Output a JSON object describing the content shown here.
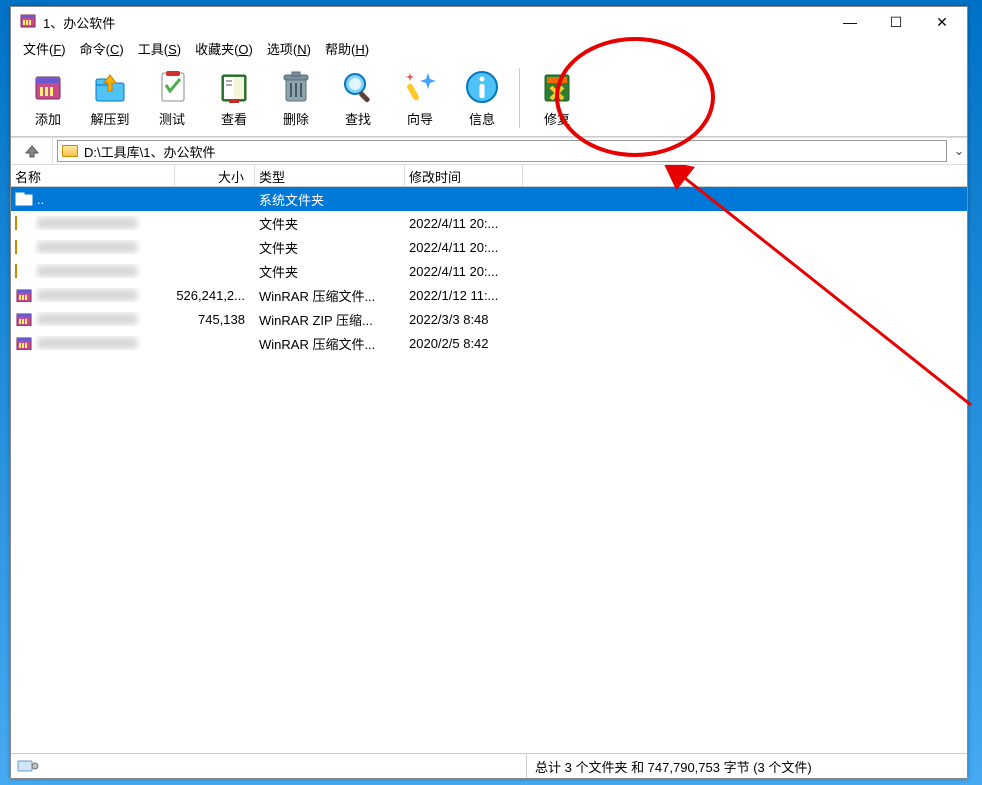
{
  "window": {
    "title": "1、办公软件",
    "controls": {
      "min": "—",
      "max": "☐",
      "close": "✕"
    }
  },
  "menubar": [
    {
      "label": "文件",
      "accel": "F"
    },
    {
      "label": "命令",
      "accel": "C"
    },
    {
      "label": "工具",
      "accel": "S"
    },
    {
      "label": "收藏夹",
      "accel": "O"
    },
    {
      "label": "选项",
      "accel": "N"
    },
    {
      "label": "帮助",
      "accel": "H"
    }
  ],
  "toolbar": [
    {
      "id": "add",
      "label": "添加"
    },
    {
      "id": "extract",
      "label": "解压到"
    },
    {
      "id": "test",
      "label": "测试"
    },
    {
      "id": "view",
      "label": "查看"
    },
    {
      "id": "delete",
      "label": "删除"
    },
    {
      "id": "find",
      "label": "查找"
    },
    {
      "id": "wizard",
      "label": "向导"
    },
    {
      "id": "info",
      "label": "信息"
    },
    {
      "id": "repair",
      "label": "修复"
    }
  ],
  "address": "D:\\工具库\\1、办公软件",
  "columns": {
    "name": "名称",
    "size": "大小",
    "type": "类型",
    "date": "修改时间"
  },
  "files": [
    {
      "name": "..",
      "blurred": false,
      "size": "",
      "type": "系统文件夹",
      "date": "",
      "icon": "up-folder",
      "selected": true
    },
    {
      "name": "",
      "blurred": true,
      "size": "",
      "type": "文件夹",
      "date": "2022/4/11 20:...",
      "icon": "folder",
      "selected": false
    },
    {
      "name": "",
      "blurred": true,
      "size": "",
      "type": "文件夹",
      "date": "2022/4/11 20:...",
      "icon": "folder",
      "selected": false
    },
    {
      "name": "",
      "blurred": true,
      "size": "",
      "type": "文件夹",
      "date": "2022/4/11 20:...",
      "icon": "folder",
      "selected": false
    },
    {
      "name": "",
      "blurred": true,
      "size": "526,241,2...",
      "type": "WinRAR 压缩文件...",
      "date": "2022/1/12 11:...",
      "icon": "rar",
      "selected": false
    },
    {
      "name": "",
      "blurred": true,
      "size": "745,138",
      "type": "WinRAR ZIP 压缩...",
      "date": "2022/3/3 8:48",
      "icon": "rar",
      "selected": false
    },
    {
      "name": "",
      "blurred": true,
      "size": "",
      "type": "WinRAR 压缩文件...",
      "date": "2020/2/5 8:42",
      "icon": "rar",
      "selected": false
    }
  ],
  "statusbar": {
    "right": "总计 3 个文件夹 和 747,790,753 字节 (3 个文件)"
  }
}
